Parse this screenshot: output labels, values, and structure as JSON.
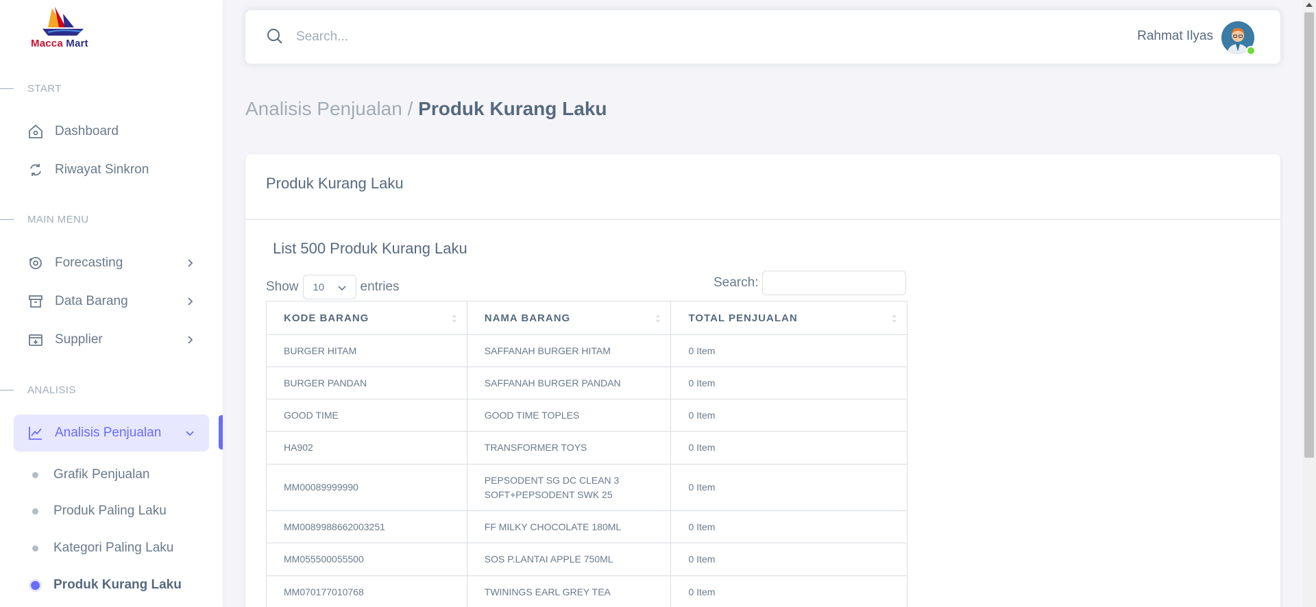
{
  "brand": {
    "name_part1": "Macca",
    "name_part2": "Mart"
  },
  "sidebar": {
    "sections": [
      {
        "header": "Start"
      },
      {
        "header": "Main Menu"
      },
      {
        "header": "Analisis"
      }
    ],
    "items": [
      {
        "label": "Dashboard",
        "icon": "home-icon"
      },
      {
        "label": "Riwayat Sinkron",
        "icon": "sync-icon"
      },
      {
        "label": "Forecasting",
        "icon": "forecast-icon"
      },
      {
        "label": "Data Barang",
        "icon": "archive-icon"
      },
      {
        "label": "Supplier",
        "icon": "box-icon"
      },
      {
        "label": "Analisis Penjualan",
        "icon": "line-chart-icon"
      }
    ],
    "subitems": [
      {
        "label": "Grafik Penjualan"
      },
      {
        "label": "Produk Paling Laku"
      },
      {
        "label": "Kategori Paling Laku"
      },
      {
        "label": "Produk Kurang Laku"
      }
    ],
    "accent_color": "#696cff"
  },
  "navbar": {
    "search_placeholder": "Search...",
    "user_name": "Rahmat Ilyas"
  },
  "breadcrumb": {
    "parent": "Analisis Penjualan /",
    "current": "Produk Kurang Laku"
  },
  "card": {
    "title": "Produk Kurang Laku",
    "list_title": "List 500 Produk Kurang Laku",
    "show_label": "Show",
    "entries_value": "10",
    "entries_label": "entries",
    "search_label": "Search:"
  },
  "table": {
    "headers": [
      "KODE BARANG",
      "NAMA BARANG",
      "TOTAL PENJUALAN"
    ],
    "rows": [
      [
        "BURGER HITAM",
        "SAFFANAH BURGER HITAM",
        "0 Item"
      ],
      [
        "BURGER PANDAN",
        "SAFFANAH BURGER PANDAN",
        "0 Item"
      ],
      [
        "GOOD TIME",
        "GOOD TIME TOPLES",
        "0 Item"
      ],
      [
        "HA902",
        "TRANSFORMER TOYS",
        "0 Item"
      ],
      [
        "MM00089999990",
        "PEPSODENT SG DC CLEAN 3 SOFT+PEPSODENT SWK 25",
        "0 Item"
      ],
      [
        "MM0089988662003251",
        "FF MILKY CHOCOLATE 180ML",
        "0 Item"
      ],
      [
        "MM055500055500",
        "SOS P.LANTAI APPLE 750ML",
        "0 Item"
      ],
      [
        "MM070177010768",
        "TWININGS EARL GREY TEA",
        "0 Item"
      ]
    ]
  }
}
